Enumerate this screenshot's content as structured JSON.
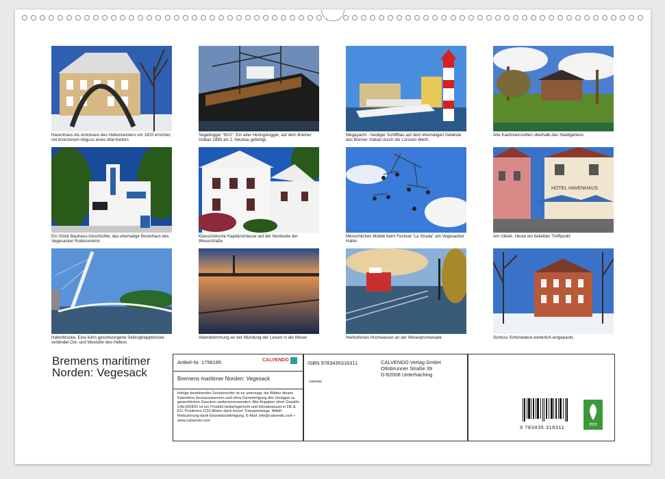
{
  "photos": [
    {
      "caption": "Havenhaus  Als Amtshaus des Hafenmeisters um 1820 errichtet, mit bronzenem Abguss eines Wal-Kiefers"
    },
    {
      "caption": "Segellogger \"BV2\". Ein alter Heringslogger, auf dem Bremer Vulkan 1895 als 2. Neubau gefertigt."
    },
    {
      "caption": "Megayacht - heutiger Schiffbau auf dem ehemaligen Gelände des Bremer Vulkan durch die Lürssen Werft."
    },
    {
      "caption": "Alte Kaufmannsvillen oberhalb des Stadtgartens"
    },
    {
      "caption": "Ein Stück Bauhaus-Geschichte, das ehemalige Bootshaus des Vegesacker Rudervereins"
    },
    {
      "caption": "Klassizistische Kapitänshäuser auf der Nordseite der Weserstraße"
    },
    {
      "caption": "Menschliches Mobile beim Festival \"La Strada\" am Vegesacker Hafen"
    },
    {
      "caption": "Am Utkiek. Heute ein beliebter Treffpunkt"
    },
    {
      "caption": "Hafenbrücke. Eine kühn geschwungene Seilzugklappbrücke verbindet Ost- und Westufer des Hafens"
    },
    {
      "caption": "Abendstimmung an der Mündung der Lesum in die Weser"
    },
    {
      "caption": "Herbstliches Hochwasser an der Weserpromenade"
    },
    {
      "caption": "Schloss Schönebeck winterlich eingepackt."
    }
  ],
  "overlay_text": {
    "hotel_sign": "HOTEL HAVENHAUS"
  },
  "title": "Bremens maritimer Norden: Vegesack",
  "info": {
    "article": "Artikel-Nr. 1756185",
    "brand": "CALVENDO",
    "subtitle": "Bremens maritimer Norden: Vegesack",
    "legal": "Infolge bestehender Schutzrechte ist es untersagt, die Blätter dieses Kalenders herauszutrennen und ohne Genehmigung des Verlages zu gewerblichen Zwecken weiterzuverwenden. Alle Angaben ohne Gewähr. CALVENDO ist ein Produkt bedarfsgerecht und klimabewusst in DE & EU. Positivere CO2-Bilanz dank kürzer Transportwege. Abfall-Reduzierung dank Einzelstückfertigung. E-Mail: info@calvendo.com • www.calvendo.com",
    "isbn": "ISBN 9783435316311",
    "publisher": [
      "CALVENDO Verlag GmbH",
      "Ottobrunner Straße 39",
      "D-82008 Unterhaching"
    ],
    "author": "rsiemer",
    "barcode_number": "9 783435 316311",
    "eco_label": "eco"
  }
}
